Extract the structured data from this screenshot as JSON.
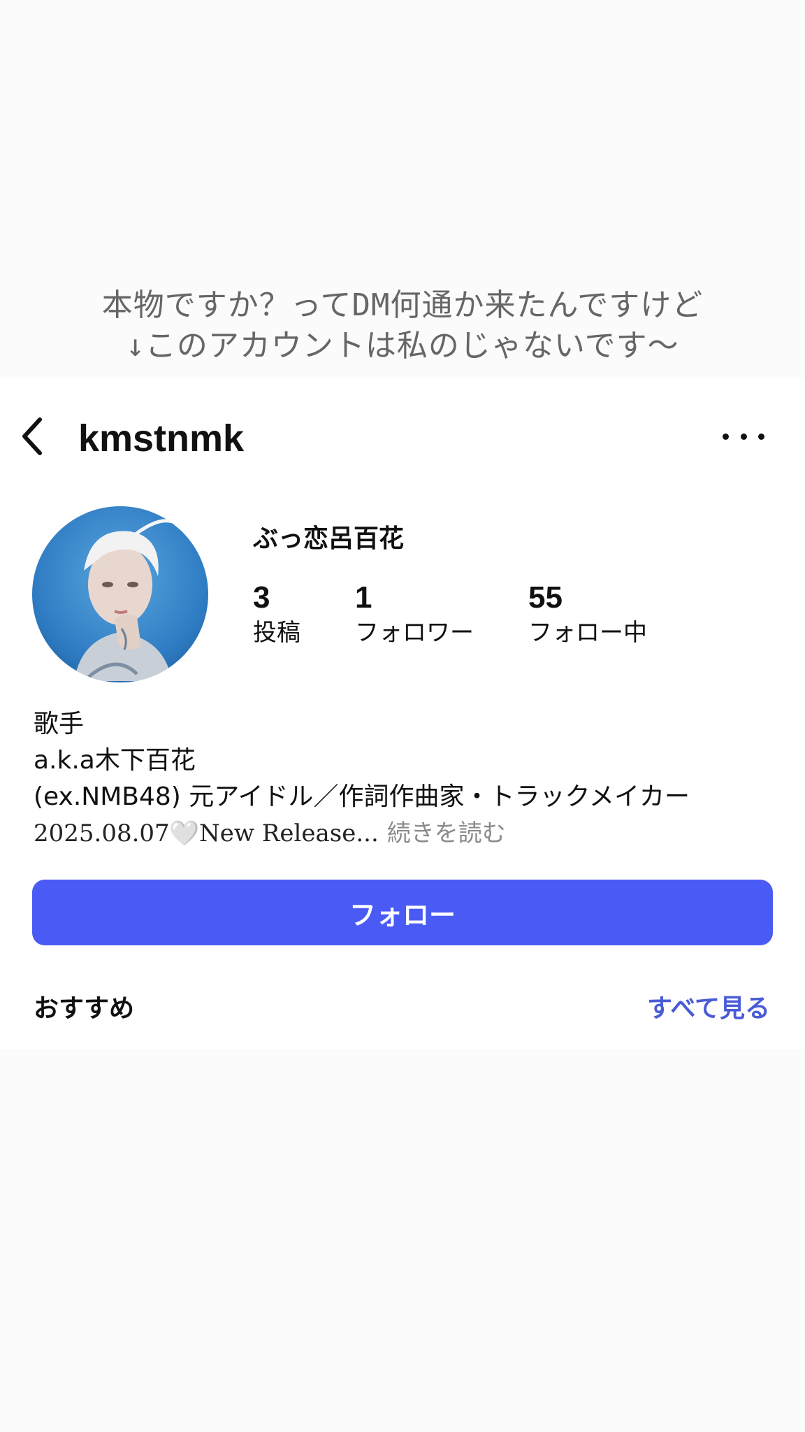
{
  "caption": {
    "line1": "本物ですか？ってDM何通か来たんですけど",
    "line2": "↓このアカウントは私のじゃないです～"
  },
  "header": {
    "back_icon": "chevron-left-icon",
    "username": "kmstnmk",
    "more_icon": "more-horizontal-icon"
  },
  "profile": {
    "display_name": "ぶっ恋呂百花",
    "stats": [
      {
        "value": "3",
        "label": "投稿"
      },
      {
        "value": "1",
        "label": "フォロワー"
      },
      {
        "value": "55",
        "label": "フォロー中"
      }
    ],
    "bio": {
      "line1": "歌手",
      "line2": "a.k.a木下百花",
      "line3": "(ex.NMB48) 元アイドル／作詞作曲家・トラックメイカー",
      "release_date": "2025.08.07",
      "heart": "🤍",
      "release_text": "New Release...",
      "read_more": "続きを読む"
    }
  },
  "follow_button": {
    "label": "フォロー",
    "color": "#4a5bf5"
  },
  "suggestions": {
    "title": "おすすめ",
    "see_all": "すべて見る"
  }
}
